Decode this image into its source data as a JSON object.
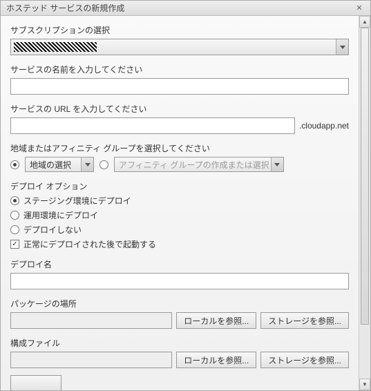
{
  "title": "ホステッド サービスの新規作成",
  "subscription": {
    "label": "サブスクリプションの選択",
    "value_obscured": true
  },
  "service_name": {
    "label": "サービスの名前を入力してください",
    "value": ""
  },
  "service_url": {
    "label": "サービスの URL を入力してください",
    "value": "",
    "suffix": ".cloudapp.net"
  },
  "region": {
    "label": "地域またはアフィニティ グループを選択してください",
    "choose_region_label": "地域の選択",
    "affinity_label": "アフィニティ グループの作成または選択",
    "selected": "region"
  },
  "deploy_options": {
    "label": "デプロイ オプション",
    "options": [
      {
        "label": "ステージング環境にデプロイ",
        "checked": true
      },
      {
        "label": "運用環境にデプロイ",
        "checked": false
      },
      {
        "label": "デプロイしない",
        "checked": false
      }
    ],
    "start_after_label": "正常にデプロイされた後で起動する",
    "start_after_checked": true
  },
  "deploy_name": {
    "label": "デプロイ名",
    "value": ""
  },
  "package": {
    "label": "パッケージの場所",
    "value": "",
    "browse_local": "ローカルを参照...",
    "browse_storage": "ストレージを参照..."
  },
  "config": {
    "label": "構成ファイル",
    "value": "",
    "browse_local": "ローカルを参照...",
    "browse_storage": "ストレージを参照..."
  }
}
